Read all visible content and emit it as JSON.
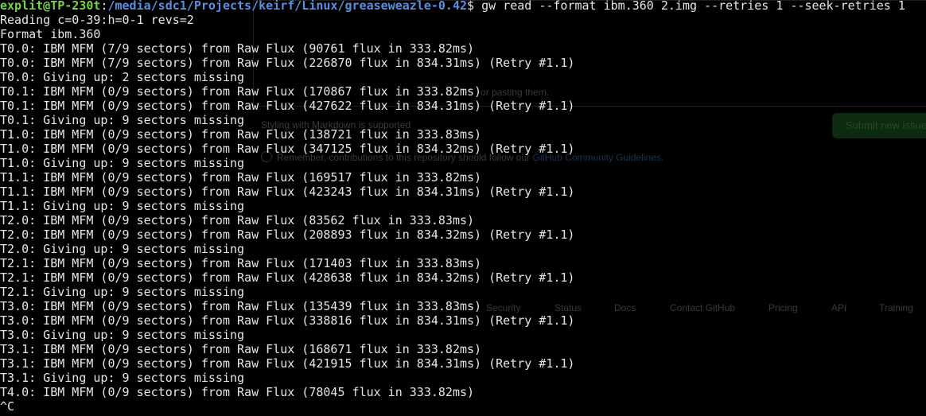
{
  "ghost": {
    "hint_text": "or pasting them.",
    "paste_text": "Styling with Markdown is supported",
    "submit_label": "Submit new issue",
    "notice_prefix": "Remember, contributions to this repository should follow our",
    "notice_link": "GitHub Community Guidelines.",
    "footer_links": [
      "Security",
      "Status",
      "Docs",
      "Contact GitHub",
      "Pricing",
      "API",
      "Training"
    ]
  },
  "terminal": {
    "prompt": {
      "user_host": "explit@TP-230t",
      "colon": ":",
      "path": "/media/sdc1/Projects/keirf/Linux/greaseweazle-0.42",
      "dollar": "$ ",
      "command": "gw read --format ibm.360 2.img --retries 1 --seek-retries 1"
    },
    "lines": [
      "Reading c=0-39:h=0-1 revs=2",
      "Format ibm.360",
      "T0.0: IBM MFM (7/9 sectors) from Raw Flux (90761 flux in 333.82ms)",
      "T0.0: IBM MFM (7/9 sectors) from Raw Flux (226870 flux in 834.31ms) (Retry #1.1)",
      "T0.0: Giving up: 2 sectors missing",
      "T0.1: IBM MFM (0/9 sectors) from Raw Flux (170867 flux in 333.82ms)",
      "T0.1: IBM MFM (0/9 sectors) from Raw Flux (427622 flux in 834.31ms) (Retry #1.1)",
      "T0.1: Giving up: 9 sectors missing",
      "T1.0: IBM MFM (0/9 sectors) from Raw Flux (138721 flux in 333.83ms)",
      "T1.0: IBM MFM (0/9 sectors) from Raw Flux (347125 flux in 834.32ms) (Retry #1.1)",
      "T1.0: Giving up: 9 sectors missing",
      "T1.1: IBM MFM (0/9 sectors) from Raw Flux (169517 flux in 333.82ms)",
      "T1.1: IBM MFM (0/9 sectors) from Raw Flux (423243 flux in 834.31ms) (Retry #1.1)",
      "T1.1: Giving up: 9 sectors missing",
      "T2.0: IBM MFM (0/9 sectors) from Raw Flux (83562 flux in 333.83ms)",
      "T2.0: IBM MFM (0/9 sectors) from Raw Flux (208893 flux in 834.32ms) (Retry #1.1)",
      "T2.0: Giving up: 9 sectors missing",
      "T2.1: IBM MFM (0/9 sectors) from Raw Flux (171403 flux in 333.83ms)",
      "T2.1: IBM MFM (0/9 sectors) from Raw Flux (428638 flux in 834.32ms) (Retry #1.1)",
      "T2.1: Giving up: 9 sectors missing",
      "T3.0: IBM MFM (0/9 sectors) from Raw Flux (135439 flux in 333.83ms)",
      "T3.0: IBM MFM (0/9 sectors) from Raw Flux (338816 flux in 834.31ms) (Retry #1.1)",
      "T3.0: Giving up: 9 sectors missing",
      "T3.1: IBM MFM (0/9 sectors) from Raw Flux (168671 flux in 333.82ms)",
      "T3.1: IBM MFM (0/9 sectors) from Raw Flux (421915 flux in 834.31ms) (Retry #1.1)",
      "T3.1: Giving up: 9 sectors missing",
      "T4.0: IBM MFM (0/9 sectors) from Raw Flux (78045 flux in 333.82ms)",
      "^C"
    ]
  },
  "colors": {
    "background": "#000000",
    "text": "#e6e6e6",
    "prompt_user": "#76d34a",
    "prompt_path": "#5a8fe0"
  }
}
